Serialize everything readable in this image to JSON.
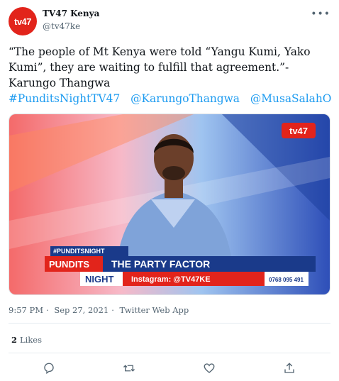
{
  "tweet": {
    "account_name": "TV47 Kenya",
    "handle": "@tv47ke",
    "avatar_text": "tv47",
    "text": "“The people of Mt Kenya were told “Yangu Kumi, Yako Kumi”, they are waiting to fulfill that agreement.”- Karungo Thangwa",
    "hashtags": [
      "#PunditsNightTV47",
      "@KarungoThangwa",
      "@MusaSalahO"
    ],
    "time": "9:57 PM",
    "separator": "·",
    "date": "Sep 27, 2021",
    "source": "Twitter Web App",
    "likes_count": "2",
    "likes_label": "Likes"
  },
  "video": {
    "channel_logo": "tv47",
    "tag": "#PUNDITSNIGHT",
    "show_line1": "PUNDITS",
    "show_line2": "NIGHT",
    "headline": "THE PARTY FACTOR",
    "instagram": "Instagram: @TV47KE",
    "phone": "0768 095 491"
  },
  "icons": [
    "more-icon",
    "reply-icon",
    "retweet-icon",
    "like-icon",
    "share-icon"
  ],
  "colors": {
    "brand_red": "#e2241b",
    "link_blue": "#1d9bf0",
    "lower_third_blue": "#1a3a8a"
  }
}
